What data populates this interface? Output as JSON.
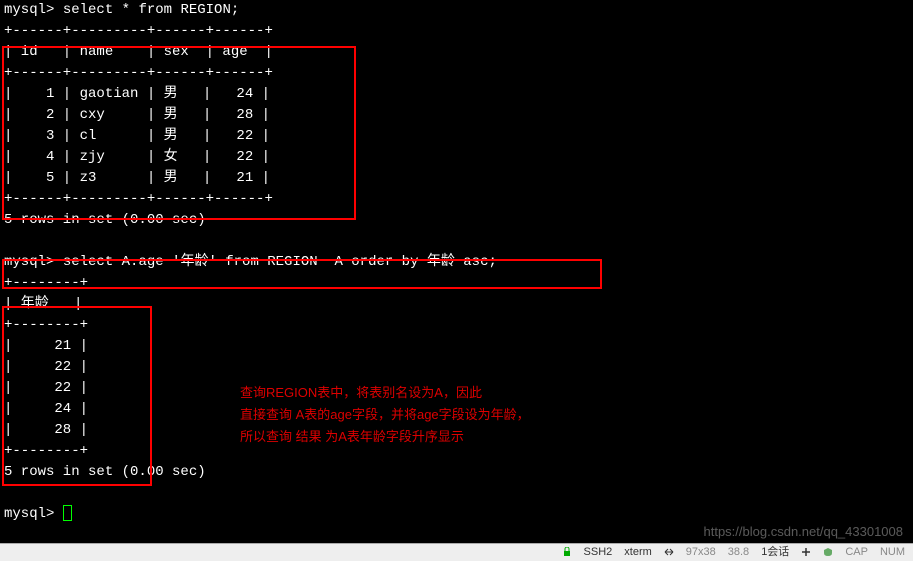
{
  "prompt": "mysql>",
  "query1": "select * from REGION;",
  "divider_top": "+------+---------+------+------+",
  "table1": {
    "header": "| id   | name    | sex  | age  |",
    "rows": [
      {
        "id": 1,
        "name": "gaotian",
        "sex": "男",
        "age": 24
      },
      {
        "id": 2,
        "name": "cxy",
        "sex": "男",
        "age": 28
      },
      {
        "id": 3,
        "name": "cl",
        "sex": "男",
        "age": 22
      },
      {
        "id": 4,
        "name": "zjy",
        "sex": "女",
        "age": 22
      },
      {
        "id": 5,
        "name": "z3",
        "sex": "男",
        "age": 21
      }
    ],
    "row_lines": [
      "|    1 | gaotian | 男   |   24 |",
      "|    2 | cxy     | 男   |   28 |",
      "|    3 | cl      | 男   |   22 |",
      "|    4 | zjy     | 女   |   22 |",
      "|    5 | z3      | 男   |   21 |"
    ]
  },
  "result1_msg": "5 rows in set (0.00 sec)",
  "query2": "select A.age '年龄' from REGION  A order by 年龄 asc;",
  "divider2": "+--------+",
  "table2": {
    "header": "| 年龄   |",
    "values": [
      21,
      22,
      22,
      24,
      28
    ],
    "row_lines": [
      "|     21 |",
      "|     22 |",
      "|     22 |",
      "|     24 |",
      "|     28 |"
    ]
  },
  "result2_msg": "5 rows in set (0.00 sec)",
  "annotation": {
    "line1": "查询REGION表中，将表别名设为A，因此",
    "line2": "直接查询 A表的age字段，并将age字段设为年龄，",
    "line3": "所以查询 结果 为A表年龄字段升序显示"
  },
  "watermark": "https://blog.csdn.net/qq_43301008",
  "statusbar": {
    "conn": "SSH2",
    "term": "xterm",
    "size": "97x38",
    "pos": "38.8",
    "session": "1会话",
    "caps": "CAP",
    "num": "NUM"
  },
  "chart_data": {
    "type": "table",
    "tables": [
      {
        "name": "REGION",
        "columns": [
          "id",
          "name",
          "sex",
          "age"
        ],
        "rows": [
          [
            1,
            "gaotian",
            "男",
            24
          ],
          [
            2,
            "cxy",
            "男",
            28
          ],
          [
            3,
            "cl",
            "男",
            22
          ],
          [
            4,
            "zjy",
            "女",
            22
          ],
          [
            5,
            "z3",
            "男",
            21
          ]
        ]
      },
      {
        "name": "年龄",
        "columns": [
          "年龄"
        ],
        "rows": [
          [
            21
          ],
          [
            22
          ],
          [
            22
          ],
          [
            24
          ],
          [
            28
          ]
        ]
      }
    ]
  }
}
